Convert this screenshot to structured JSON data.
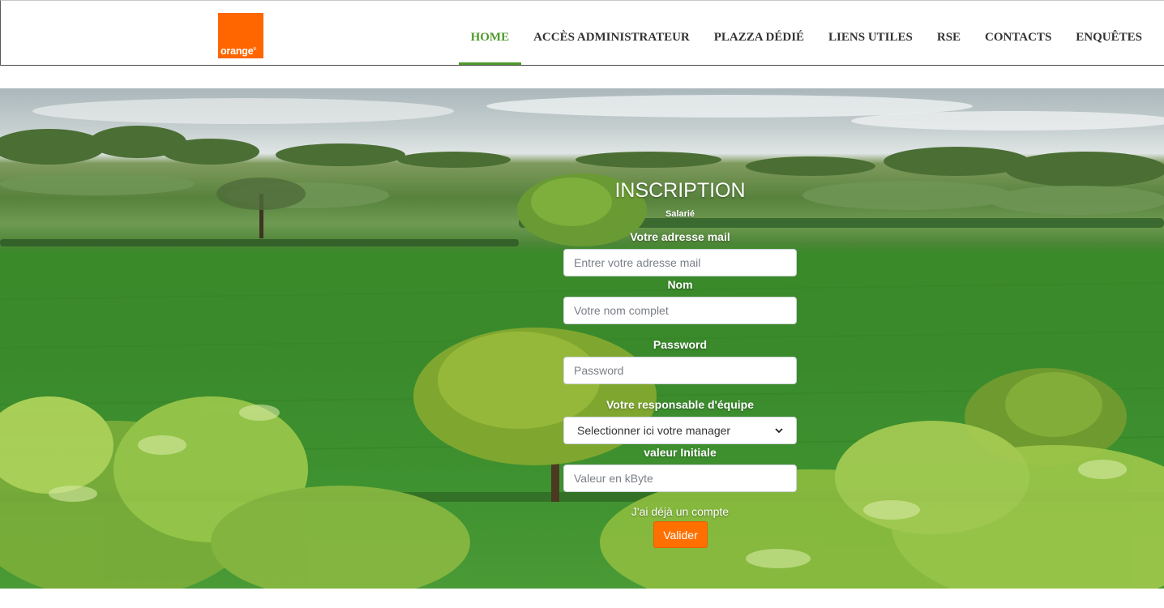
{
  "brand": {
    "logo_text": "orange",
    "logo_mark": "®",
    "color": "#ff6600"
  },
  "nav": {
    "items": [
      {
        "label": "HOME",
        "active": true
      },
      {
        "label": "ACCÈS ADMINISTRATEUR",
        "active": false
      },
      {
        "label": "PLAZZA DÉDIÉ",
        "active": false
      },
      {
        "label": "LIENS UTILES",
        "active": false
      },
      {
        "label": "RSE",
        "active": false
      },
      {
        "label": "CONTACTS",
        "active": false
      },
      {
        "label": "ENQUÊTES",
        "active": false
      }
    ],
    "active_color": "#4e9a2c"
  },
  "form": {
    "title": "INSCRIPTION",
    "subtitle": "Salarié",
    "email": {
      "label": "Votre adresse mail",
      "placeholder": "Entrer votre adresse mail",
      "value": ""
    },
    "name": {
      "label": "Nom",
      "placeholder": "Votre nom complet",
      "value": ""
    },
    "password": {
      "label": "Password",
      "placeholder": "Password",
      "value": ""
    },
    "manager": {
      "label": "Votre responsable d'équipe",
      "selected": "Selectionner ici votre manager"
    },
    "initial_value": {
      "label": "valeur Initiale",
      "placeholder": "Valeur en kByte",
      "value": ""
    },
    "existing_account_link": "J'ai déjà un compte",
    "submit_label": "Valider",
    "submit_color": "#ff7000"
  }
}
